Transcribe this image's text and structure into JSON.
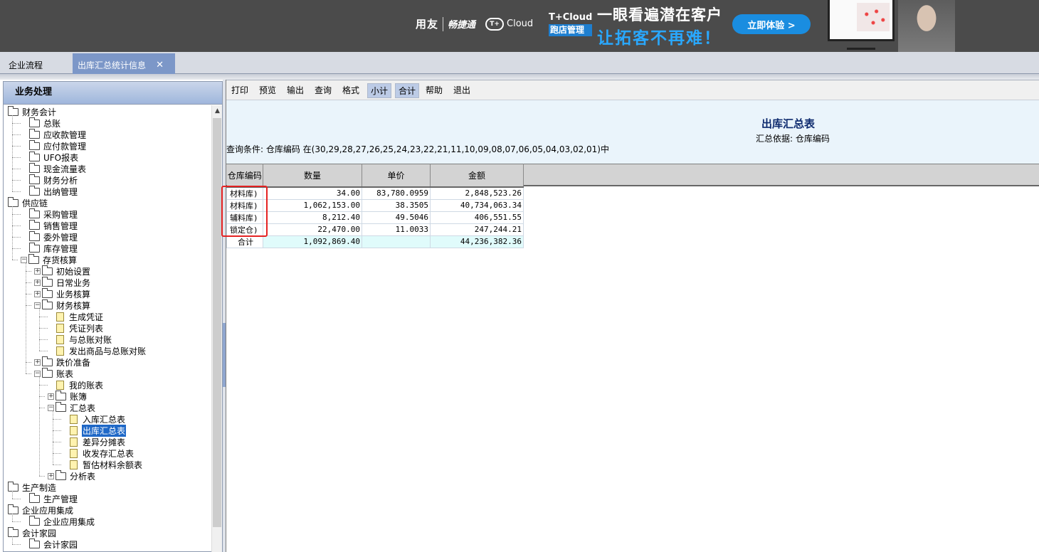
{
  "banner": {
    "brand_yonyou": "用友",
    "brand_chanjet": "畅捷通",
    "brand_cloud_icon": "T+",
    "brand_cloud": "Cloud",
    "brand_tcloud": "T+Cloud",
    "brand_tcloud_sub": "跑店管理",
    "slogan_1": "一眼看遍潜在客户",
    "slogan_2": "让拓客不再难！",
    "cta": "立即体验 >"
  },
  "tabs": {
    "flow": "企业流程",
    "report": "出库汇总统计信息",
    "close_icon": "✕"
  },
  "left_panel": {
    "title": "业务处理",
    "scroll_up_icon": "▲",
    "tree": [
      {
        "label": "财务会计",
        "level": 0,
        "type": "folder",
        "toggle": "",
        "selected": false
      },
      {
        "label": "总账",
        "level": 1,
        "type": "folder",
        "toggle": "",
        "selected": false
      },
      {
        "label": "应收款管理",
        "level": 1,
        "type": "folder",
        "toggle": "",
        "selected": false
      },
      {
        "label": "应付款管理",
        "level": 1,
        "type": "folder",
        "toggle": "",
        "selected": false
      },
      {
        "label": "UFO报表",
        "level": 1,
        "type": "folder",
        "toggle": "",
        "selected": false
      },
      {
        "label": "现金流量表",
        "level": 1,
        "type": "folder",
        "toggle": "",
        "selected": false
      },
      {
        "label": "财务分析",
        "level": 1,
        "type": "folder",
        "toggle": "",
        "selected": false
      },
      {
        "label": "出纳管理",
        "level": 1,
        "type": "folder",
        "toggle": "",
        "selected": false
      },
      {
        "label": "供应链",
        "level": 0,
        "type": "folder",
        "toggle": "",
        "selected": false
      },
      {
        "label": "采购管理",
        "level": 1,
        "type": "folder",
        "toggle": "",
        "selected": false
      },
      {
        "label": "销售管理",
        "level": 1,
        "type": "folder",
        "toggle": "",
        "selected": false
      },
      {
        "label": "委外管理",
        "level": 1,
        "type": "folder",
        "toggle": "",
        "selected": false
      },
      {
        "label": "库存管理",
        "level": 1,
        "type": "folder",
        "toggle": "",
        "selected": false
      },
      {
        "label": "存货核算",
        "level": 1,
        "type": "folder",
        "toggle": "-",
        "selected": false
      },
      {
        "label": "初始设置",
        "level": 2,
        "type": "folder",
        "toggle": "+",
        "selected": false
      },
      {
        "label": "日常业务",
        "level": 2,
        "type": "folder",
        "toggle": "+",
        "selected": false
      },
      {
        "label": "业务核算",
        "level": 2,
        "type": "folder",
        "toggle": "+",
        "selected": false
      },
      {
        "label": "财务核算",
        "level": 2,
        "type": "folder",
        "toggle": "-",
        "selected": false
      },
      {
        "label": "生成凭证",
        "level": 3,
        "type": "doc",
        "toggle": "",
        "selected": false
      },
      {
        "label": "凭证列表",
        "level": 3,
        "type": "doc",
        "toggle": "",
        "selected": false
      },
      {
        "label": "与总账对账",
        "level": 3,
        "type": "doc",
        "toggle": "",
        "selected": false
      },
      {
        "label": "发出商品与总账对账",
        "level": 3,
        "type": "doc",
        "toggle": "",
        "selected": false
      },
      {
        "label": "跌价准备",
        "level": 2,
        "type": "folder",
        "toggle": "+",
        "selected": false
      },
      {
        "label": "账表",
        "level": 2,
        "type": "folder",
        "toggle": "-",
        "selected": false
      },
      {
        "label": "我的账表",
        "level": 3,
        "type": "doc",
        "toggle": "",
        "selected": false
      },
      {
        "label": "账簿",
        "level": 3,
        "type": "folder",
        "toggle": "+",
        "selected": false
      },
      {
        "label": "汇总表",
        "level": 3,
        "type": "folder",
        "toggle": "-",
        "selected": false
      },
      {
        "label": "入库汇总表",
        "level": 4,
        "type": "doc",
        "toggle": "",
        "selected": false
      },
      {
        "label": "出库汇总表",
        "level": 4,
        "type": "doc",
        "toggle": "",
        "selected": true
      },
      {
        "label": "差异分摊表",
        "level": 4,
        "type": "doc",
        "toggle": "",
        "selected": false
      },
      {
        "label": "收发存汇总表",
        "level": 4,
        "type": "doc",
        "toggle": "",
        "selected": false
      },
      {
        "label": "暂估材料余额表",
        "level": 4,
        "type": "doc",
        "toggle": "",
        "selected": false
      },
      {
        "label": "分析表",
        "level": 3,
        "type": "folder",
        "toggle": "+",
        "selected": false
      },
      {
        "label": "生产制造",
        "level": 0,
        "type": "folder",
        "toggle": "",
        "selected": false
      },
      {
        "label": "生产管理",
        "level": 1,
        "type": "folder",
        "toggle": "",
        "selected": false
      },
      {
        "label": "企业应用集成",
        "level": 0,
        "type": "folder",
        "toggle": "",
        "selected": false
      },
      {
        "label": "企业应用集成",
        "level": 1,
        "type": "folder",
        "toggle": "",
        "selected": false
      },
      {
        "label": "会计家园",
        "level": 0,
        "type": "folder",
        "toggle": "",
        "selected": false
      },
      {
        "label": "会计家园",
        "level": 1,
        "type": "folder",
        "toggle": "",
        "selected": false
      }
    ]
  },
  "toolbar": {
    "buttons": [
      {
        "label": "打印",
        "active": false
      },
      {
        "label": "预览",
        "active": false
      },
      {
        "label": "输出",
        "active": false
      },
      {
        "label": "查询",
        "active": false
      },
      {
        "label": "格式",
        "active": false
      },
      {
        "label": "小计",
        "active": true
      },
      {
        "label": "合计",
        "active": true
      },
      {
        "label": "帮助",
        "active": false
      },
      {
        "label": "退出",
        "active": false
      }
    ]
  },
  "report": {
    "title": "出库汇总表",
    "basis": "汇总依据: 仓库编码",
    "condition": "查询条件: 仓库编码 在(30,29,28,27,26,25,24,23,22,21,11,10,09,08,07,06,05,04,03,02,01)中",
    "columns": [
      "仓库编码",
      "数量",
      "单价",
      "金额"
    ],
    "rows": [
      {
        "code": "材料库)",
        "qty": "34.00",
        "price": "83,780.0959",
        "amount": "2,848,523.26"
      },
      {
        "code": "材料库)",
        "qty": "1,062,153.00",
        "price": "38.3505",
        "amount": "40,734,063.34"
      },
      {
        "code": "辅料库)",
        "qty": "8,212.40",
        "price": "49.5046",
        "amount": "406,551.55"
      },
      {
        "code": "锁定仓)",
        "qty": "22,470.00",
        "price": "11.0033",
        "amount": "247,244.21"
      }
    ],
    "total": {
      "code": "合计",
      "qty": "1,092,869.40",
      "price": "",
      "amount": "44,236,382.36"
    }
  },
  "colors": {
    "banner_bg": "#4b4b4b",
    "tab_active": "#7c97c8",
    "selected_item": "#1f68c7",
    "highlight_box": "#e52222",
    "total_row": "#e0fbfb"
  }
}
